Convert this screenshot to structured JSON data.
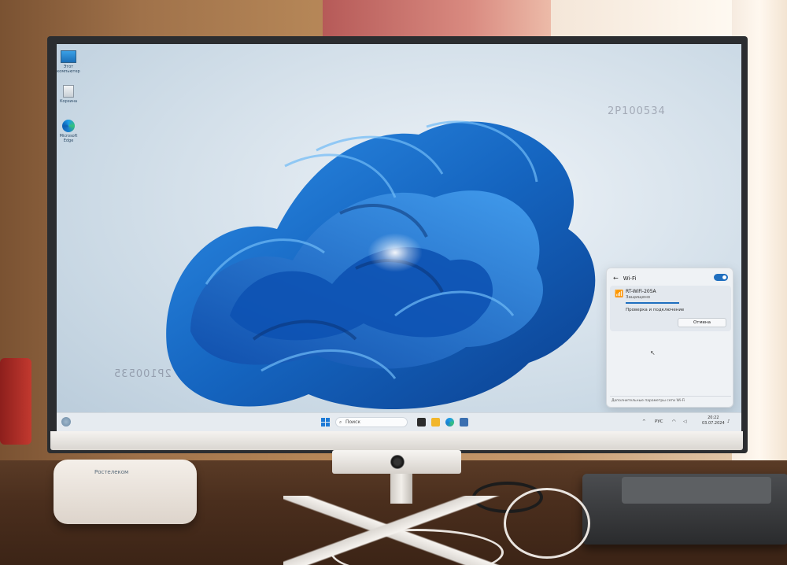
{
  "desktop": {
    "icons": [
      {
        "label": "Этот компьютер",
        "icon": "computer-icon"
      },
      {
        "label": "Корзина",
        "icon": "recycle-bin-icon"
      },
      {
        "label": "Microsoft Edge",
        "icon": "edge-icon"
      }
    ],
    "watermark_top": "2P100534",
    "watermark_left": "2P100535"
  },
  "wifi_panel": {
    "title": "Wi-Fi",
    "enabled": true,
    "network_name": "RT-WiFi-205A",
    "security": "Защищено",
    "status": "Проверка и подключение",
    "cancel_label": "Отмена",
    "footer_link": "Дополнительные параметры сети Wi-Fi"
  },
  "taskbar": {
    "search_placeholder": "Поиск",
    "language": "РУС",
    "time": "20:22",
    "date": "03.07.2024"
  },
  "router": {
    "brand": "Ростелеком"
  },
  "colors": {
    "accent": "#1f6fbf",
    "taskbar": "#e6ebf0",
    "wallpaper_blue": "#1565c0"
  }
}
